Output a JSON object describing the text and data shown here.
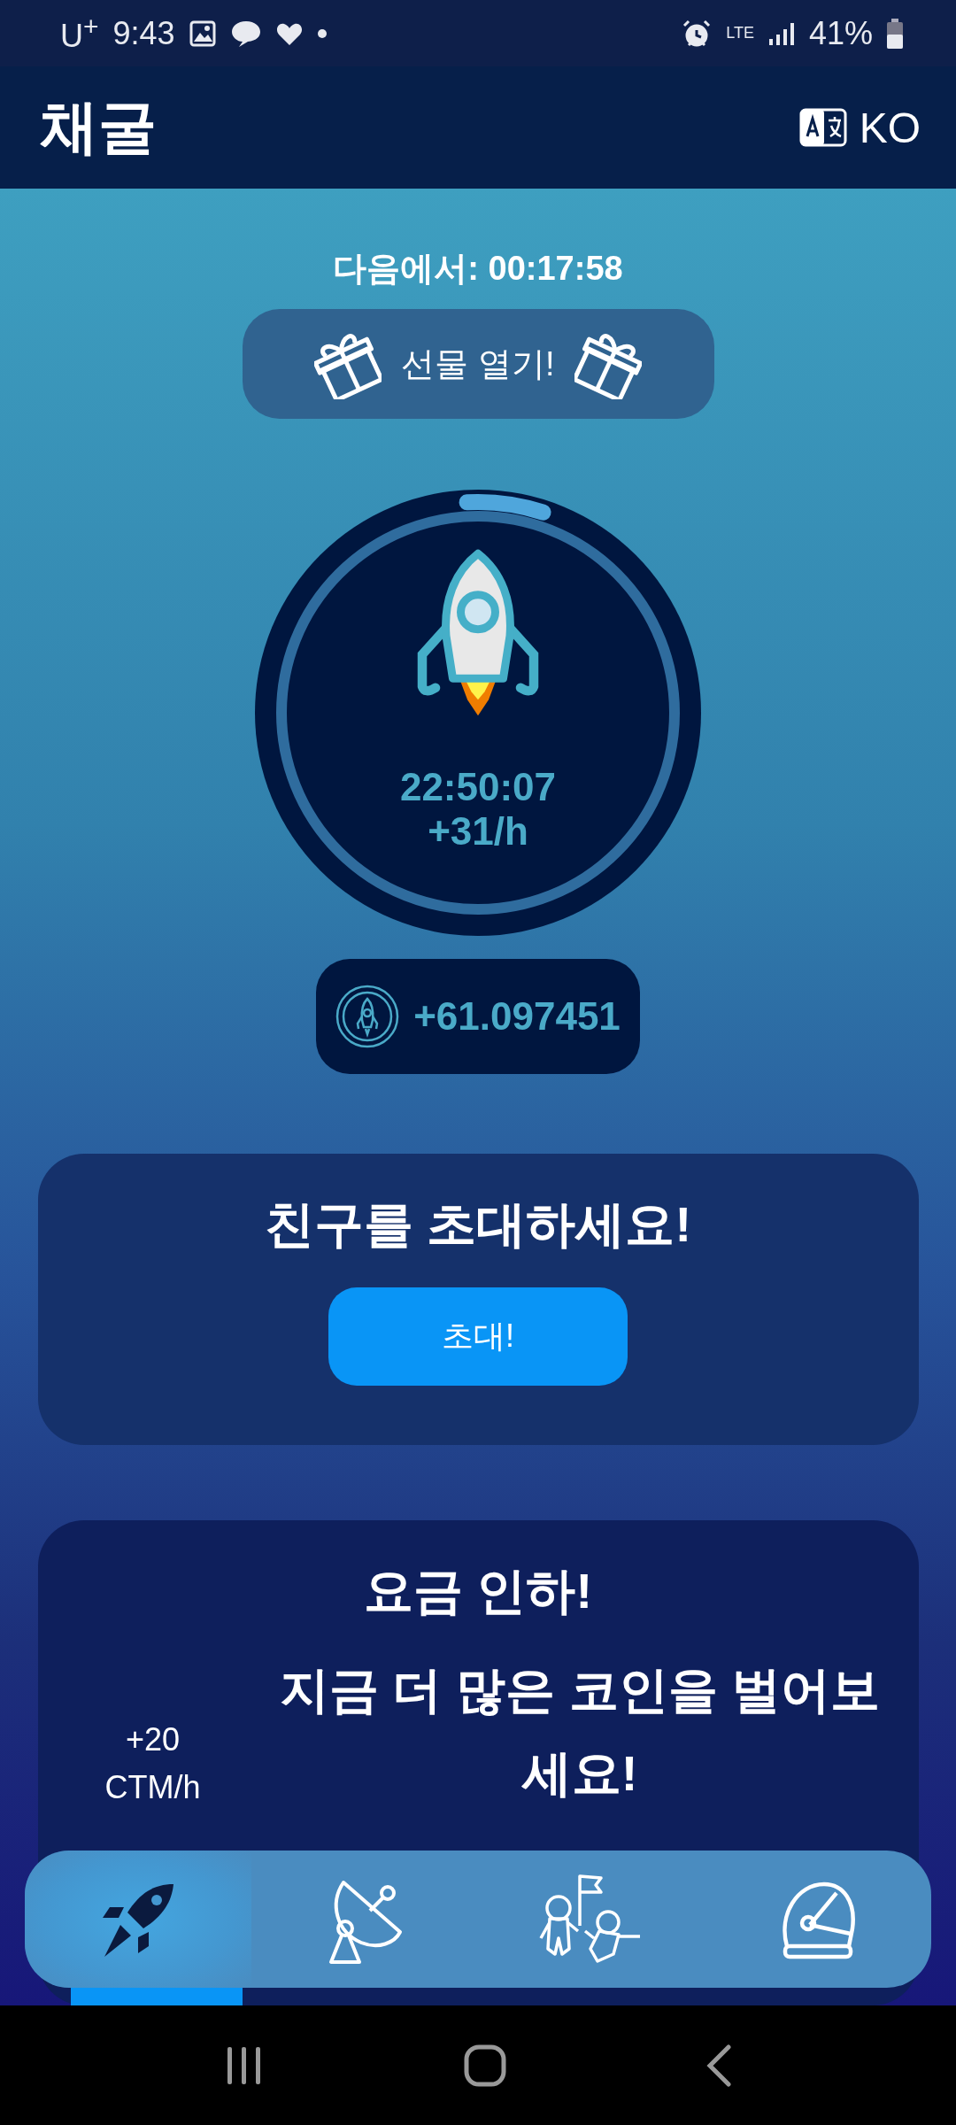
{
  "status_bar": {
    "carrier": "U$^{+}$",
    "time": "9:43",
    "network": "LTE",
    "battery": "41%"
  },
  "header": {
    "title": "채굴",
    "language": "KO"
  },
  "countdown": "다음에서: 00:17:58",
  "gift_button": {
    "label": "선물 열기!"
  },
  "mining": {
    "time": "22:50:07",
    "rate": "+31/h"
  },
  "balance": "+61.097451",
  "invite_card": {
    "title": "친구를 초대하세요!",
    "button": "초대!"
  },
  "promo_card": {
    "title": "요금 인하!",
    "bonus": [
      "+20",
      "CTM/h"
    ],
    "message": "지금 더 많은 코인을 벌어보세요!"
  },
  "bottom_nav": [
    {
      "kind": "rocket",
      "selected": true
    },
    {
      "kind": "dish",
      "selected": false
    },
    {
      "kind": "astronauts",
      "selected": false
    },
    {
      "kind": "helmet",
      "selected": false
    }
  ]
}
